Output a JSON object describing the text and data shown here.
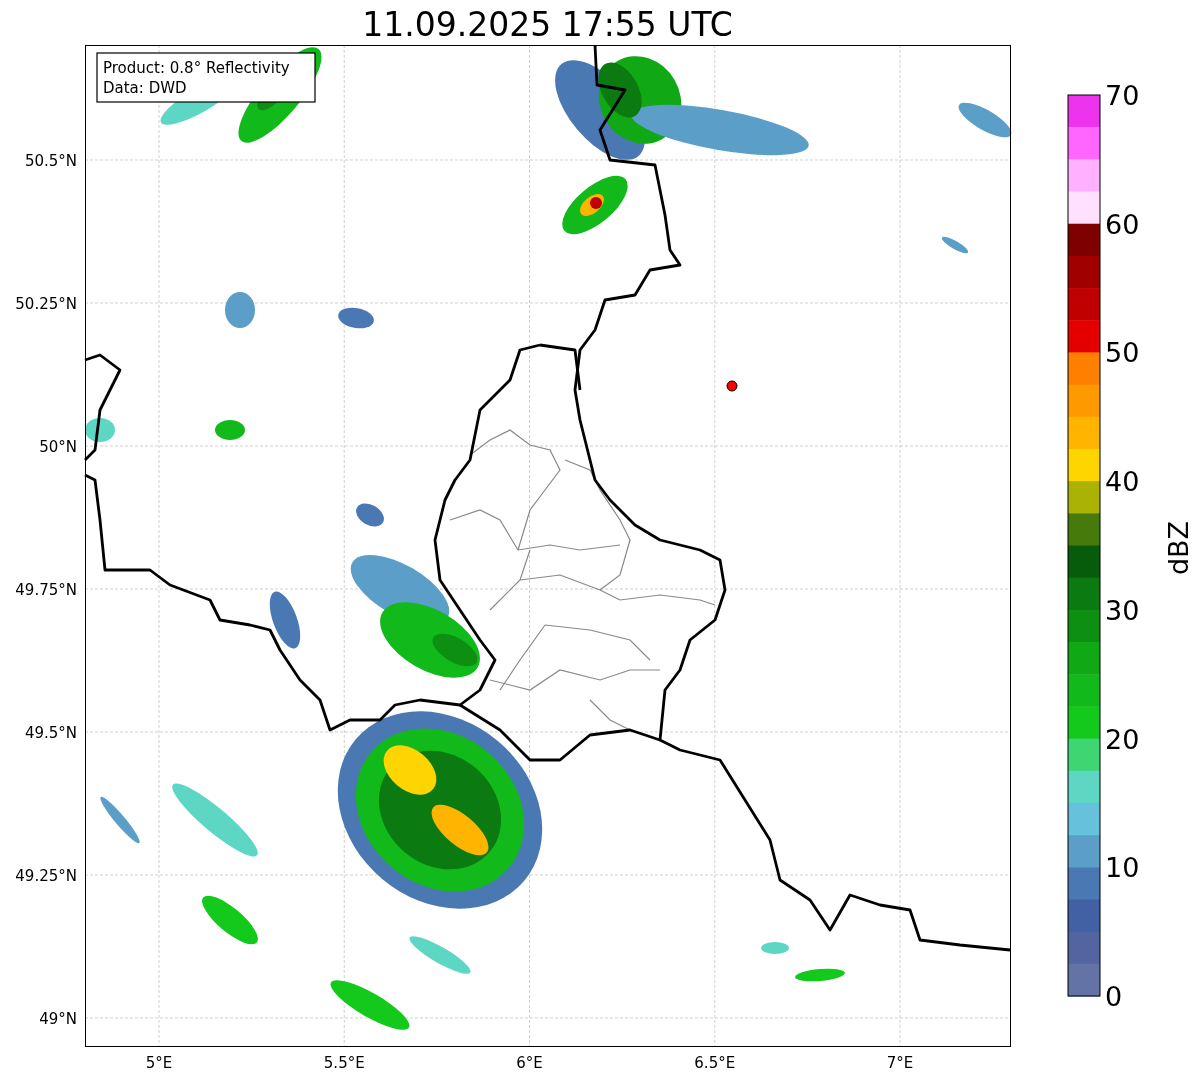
{
  "title": "11.09.2025 17:55 UTC",
  "legend": {
    "lines": [
      "Product: 0.8° Reflectivity",
      "Data: DWD"
    ]
  },
  "map": {
    "lat_labels": [
      "50.5°N",
      "50.25°N",
      "50°N",
      "49.75°N",
      "49.5°N",
      "49.25°N",
      "49°N"
    ],
    "lon_labels": [
      "5°E",
      "5.5°E",
      "6°E",
      "6.5°E",
      "7°E"
    ]
  },
  "colorbar": {
    "label": "dBZ",
    "ticks": [
      "70",
      "60",
      "50",
      "40",
      "30",
      "20",
      "10",
      "0"
    ],
    "segments": [
      {
        "color": "#ee33ee"
      },
      {
        "color": "#ff66ff"
      },
      {
        "color": "#ffb0ff"
      },
      {
        "color": "#ffe0ff"
      },
      {
        "color": "#7f0000"
      },
      {
        "color": "#a00000"
      },
      {
        "color": "#c00000"
      },
      {
        "color": "#e50000"
      },
      {
        "color": "#ff7f00"
      },
      {
        "color": "#ff9900"
      },
      {
        "color": "#ffb400"
      },
      {
        "color": "#ffd500"
      },
      {
        "color": "#aab204"
      },
      {
        "color": "#467a0a"
      },
      {
        "color": "#075c0b"
      },
      {
        "color": "#0b7a10"
      },
      {
        "color": "#0d8f12"
      },
      {
        "color": "#10a814"
      },
      {
        "color": "#12b91a"
      },
      {
        "color": "#12c91c"
      },
      {
        "color": "#3dd673"
      },
      {
        "color": "#5ed6c4"
      },
      {
        "color": "#66c1dc"
      },
      {
        "color": "#5b9ec8"
      },
      {
        "color": "#4a78b3"
      },
      {
        "color": "#4260a4"
      },
      {
        "color": "#5365a0"
      },
      {
        "color": "#6473a6"
      }
    ]
  }
}
